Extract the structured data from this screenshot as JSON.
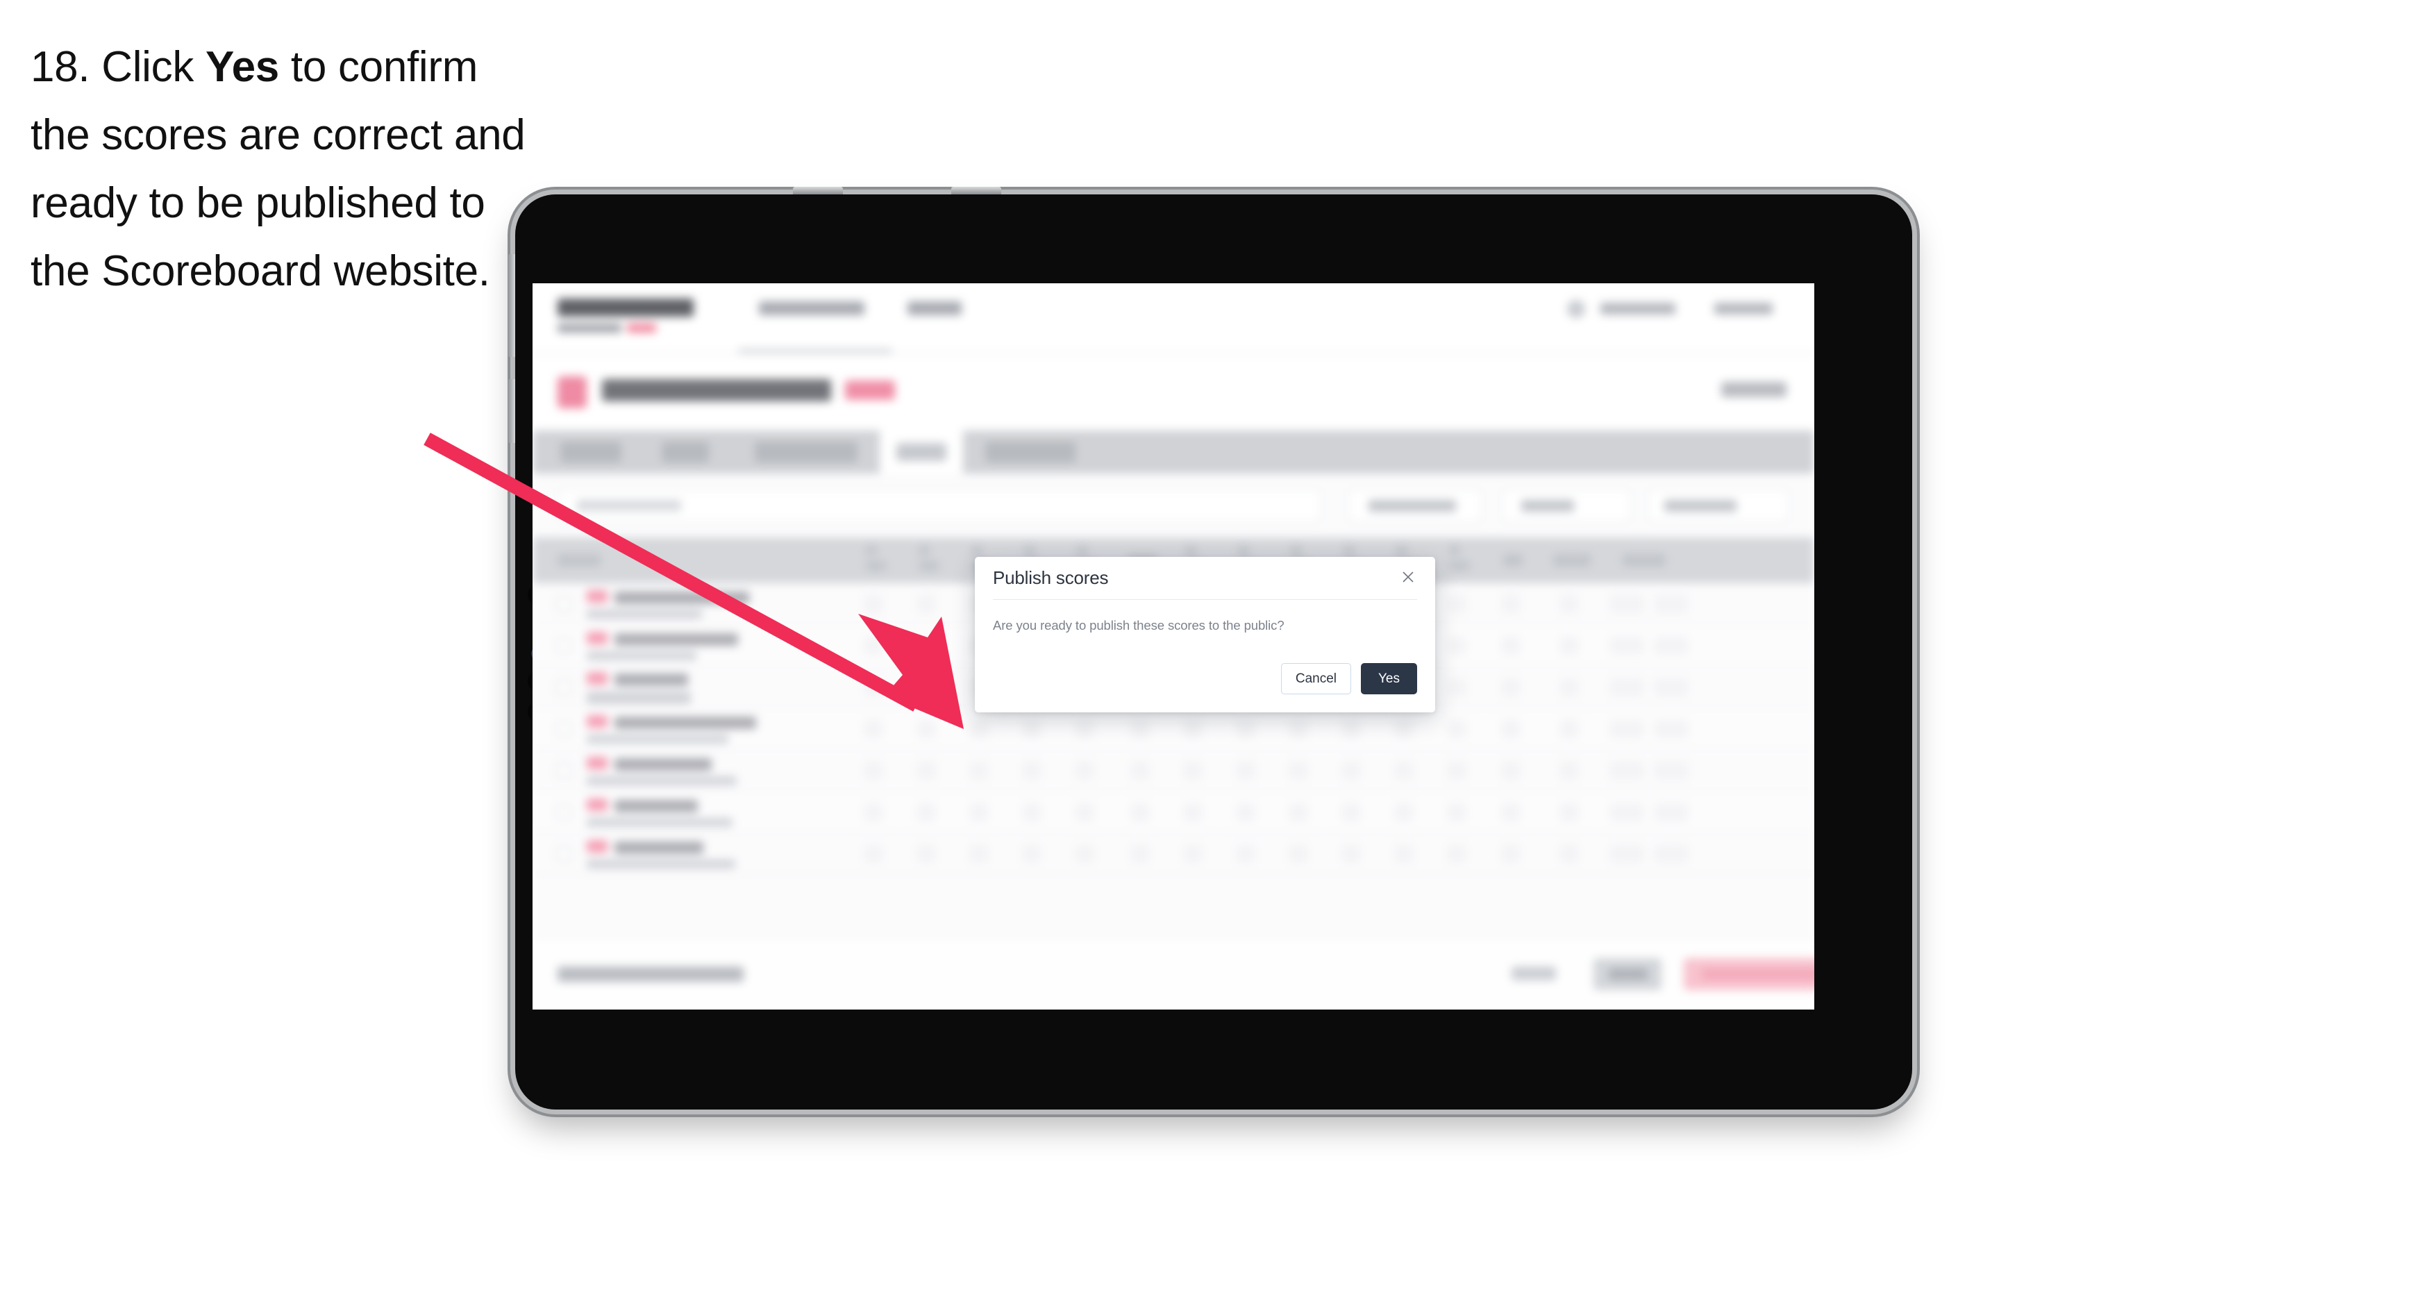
{
  "caption": {
    "step_number": "18.",
    "text_before": " Click ",
    "bold_word": "Yes",
    "text_after": " to confirm the scores are correct and ready to be published to the Scoreboard website."
  },
  "modal": {
    "title": "Publish scores",
    "body": "Are you ready to publish these scores to the public?",
    "close_icon": "close-icon",
    "cancel_label": "Cancel",
    "yes_label": "Yes"
  },
  "colors": {
    "arrow": "#ef2d56",
    "primary_button": "#2b3647",
    "brand_pink": "#ef8ba4",
    "device_body": "#0b0b0c",
    "device_edge": "#b9bbbd"
  },
  "device": {
    "type": "tablet",
    "orientation": "landscape"
  },
  "background_app": {
    "description": "blurred scoreboard results table behind modal",
    "nav_links": 2,
    "tabs_count": 5,
    "active_tab_index": 3,
    "filter_controls": 3,
    "table_rows": 7,
    "footer_buttons": 3
  }
}
